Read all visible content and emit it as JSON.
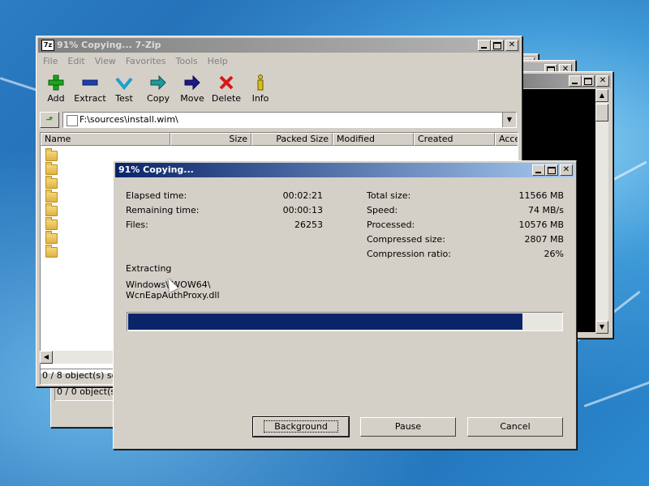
{
  "main_window": {
    "title": "91% Copying... 7-Zip",
    "app_icon": "7z",
    "menu": [
      "File",
      "Edit",
      "View",
      "Favorites",
      "Tools",
      "Help"
    ],
    "toolbar": [
      {
        "label": "Add",
        "icon": "plus-icon",
        "color": "#1aa51a"
      },
      {
        "label": "Extract",
        "icon": "minus-icon",
        "color": "#1f3fb0"
      },
      {
        "label": "Test",
        "icon": "check-icon",
        "color": "#1fa0c8"
      },
      {
        "label": "Copy",
        "icon": "arrow-right-icon",
        "color": "#1f9a9a"
      },
      {
        "label": "Move",
        "icon": "arrow-right-icon",
        "color": "#1a1a8a"
      },
      {
        "label": "Delete",
        "icon": "x-icon",
        "color": "#d81818"
      },
      {
        "label": "Info",
        "icon": "info-icon",
        "color": "#d8c018"
      }
    ],
    "address": {
      "path": "F:\\sources\\install.wim\\"
    },
    "columns": [
      "Name",
      "Size",
      "Packed Size",
      "Modified",
      "Created",
      "Acce"
    ],
    "folder_count": 8,
    "status": "0 / 8 object(s) sele"
  },
  "background_window": {
    "status": "0 / 0 object(s)"
  },
  "dialog": {
    "title": "91% Copying...",
    "left_stats": [
      {
        "label": "Elapsed time:",
        "value": "00:02:21"
      },
      {
        "label": "Remaining time:",
        "value": "00:00:13"
      },
      {
        "label": "Files:",
        "value": "26253"
      }
    ],
    "right_stats": [
      {
        "label": "Total size:",
        "value": "11566 MB"
      },
      {
        "label": "Speed:",
        "value": "74 MB/s"
      },
      {
        "label": "Processed:",
        "value": "10576 MB"
      },
      {
        "label": "Compressed size:",
        "value": "2807 MB"
      },
      {
        "label": "Compression ratio:",
        "value": "26%"
      }
    ],
    "operation": "Extracting",
    "current_path_1": "Windows\\   WOW64\\",
    "current_path_2": "WcnEapAuthProxy.dll",
    "progress": 0.91,
    "buttons": {
      "background": "Background",
      "pause": "Pause",
      "cancel": "Cancel"
    }
  }
}
